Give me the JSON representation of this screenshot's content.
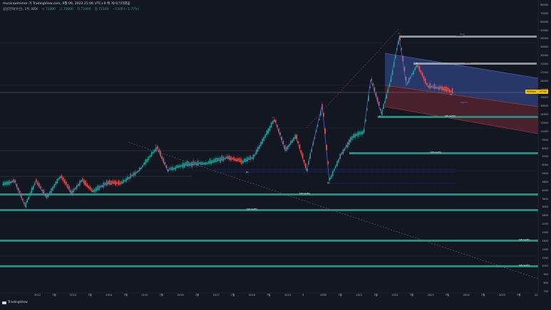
{
  "header": {
    "author_line": "musicswimmer 가 TradingView.com, 9월 09, 2023 21:06 UTC+9 에 게시(?)하였음",
    "symbol_line": "삼성전자(우선), 1주, KRX",
    "ohlc": [
      "시 72000",
      "고 72600",
      "저 71900",
      "종 72100",
      "−1300 (−1.77%)"
    ]
  },
  "y_axis": {
    "labels": [
      "80000",
      "70000",
      "60000",
      "50000",
      "45000",
      "40000",
      "35000",
      "31000",
      "27000",
      "24000",
      "21000",
      "19000",
      "16500",
      "14500",
      "12500",
      "11000",
      "9500",
      "8000",
      "7000",
      "6000",
      "5400",
      "4600",
      "4000",
      "3400",
      "3000",
      "2600",
      "2200",
      "1900",
      "1600",
      "1400",
      "1200",
      "1050",
      "900",
      "800",
      "700"
    ]
  },
  "x_axis": {
    "labels": [
      "2012",
      "7월",
      "2013",
      "7월",
      "2014",
      "7월",
      "2015",
      "7월",
      "2016",
      "7월",
      "2017",
      "7월",
      "2018",
      "7월",
      "2019",
      "9",
      "2020",
      "7월",
      "2021",
      "7월",
      "2022",
      "7월",
      "2023",
      "7월",
      "2024",
      "7월",
      "2025",
      "7월",
      "20"
    ]
  },
  "price_badges": [
    {
      "text": "RRRVAS",
      "color": "#f7c600",
      "text_color": "#131722"
    },
    {
      "text": "19760",
      "color": "#f7c600",
      "text_color": "#131722"
    }
  ],
  "zones": [
    {
      "label": "S/Zone(#5)",
      "color": "#2a8b7e"
    },
    {
      "label": "S/Zone(#5)",
      "color": "#2a8b7e"
    },
    {
      "label": "S/Zone(#5)",
      "color": "#2a8b7e"
    },
    {
      "label": "S/Zone(#5)",
      "color": "#2a8b7e"
    },
    {
      "label": "S/Zone(#5)",
      "color": "#2a8b7e"
    },
    {
      "label": "S/Zone(#5)",
      "color": "#2a8b7e"
    }
  ],
  "resistance_lines": [
    {
      "label": "S/R(#)",
      "color": "#bdbdbd"
    },
    {
      "label": "S/R(#)",
      "color": "#bdbdbd"
    }
  ],
  "channel_labels": [
    "Fib(1)",
    "Fib(0.5)"
  ],
  "wave_labels": [
    "(1)",
    "(2)",
    "(3)",
    "(4)",
    "(5)",
    "A",
    "B",
    "C"
  ],
  "footer": {
    "brand": "TradingView"
  },
  "colors": {
    "background": "#131722",
    "up_candle": "#26a69a",
    "down_candle": "#ef5350",
    "zigzag": "#4e6fe0",
    "upper_channel": "#3f5fbf",
    "lower_channel": "#8b2e3a"
  }
}
